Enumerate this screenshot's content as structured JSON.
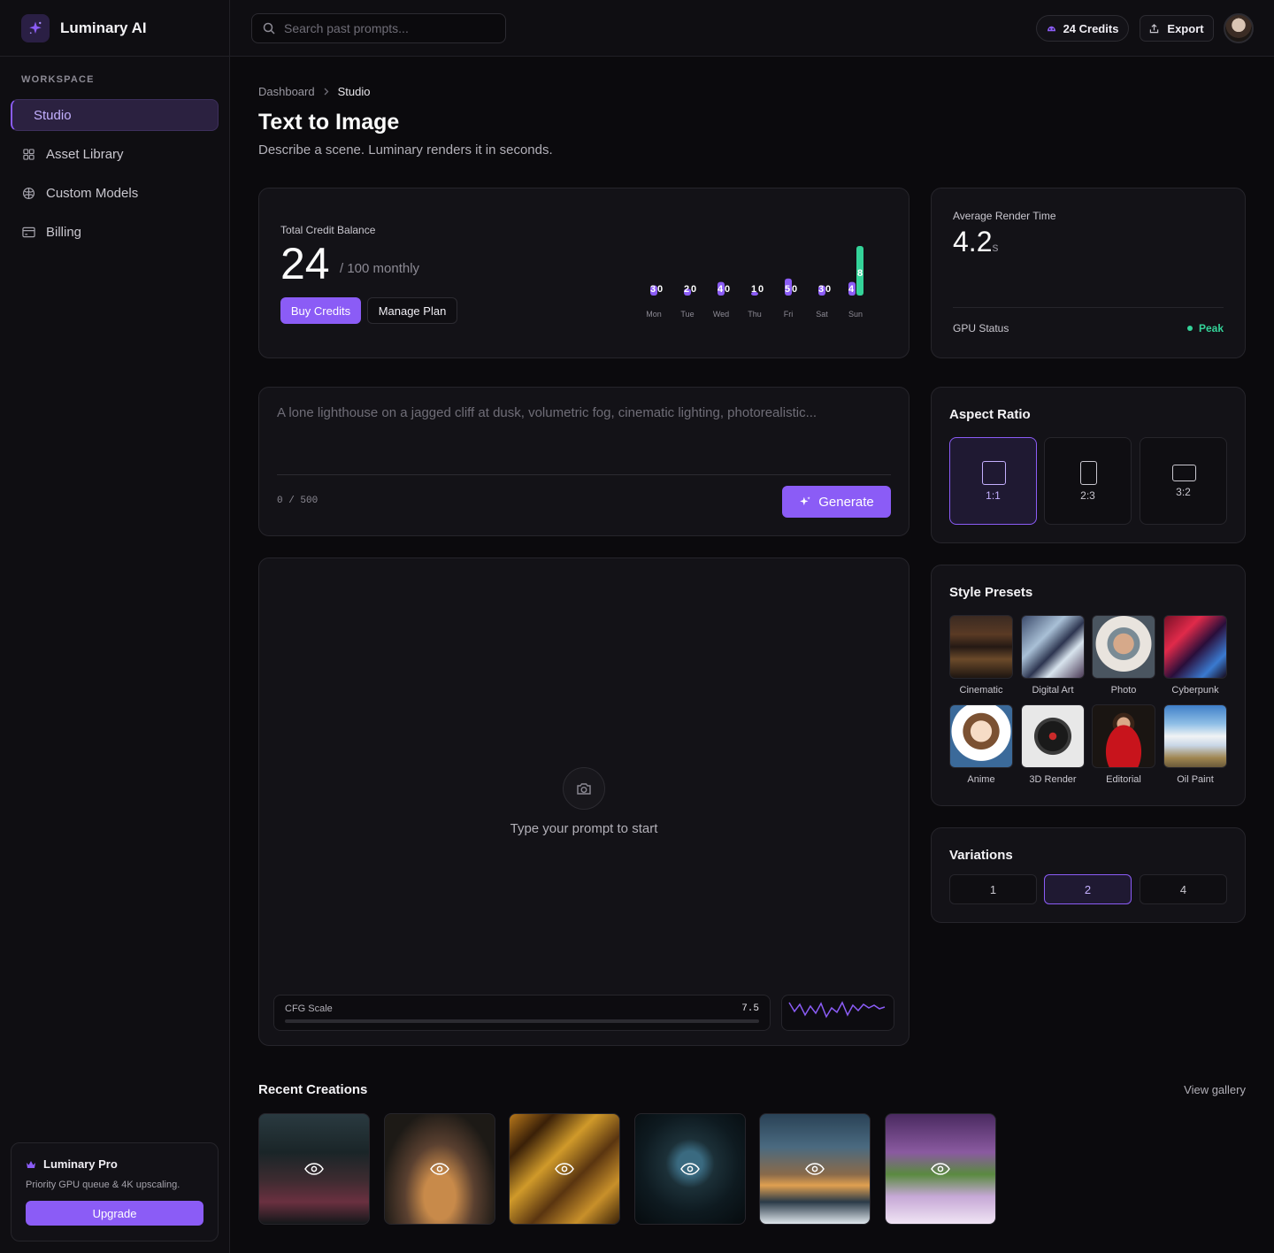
{
  "app": {
    "name": "Luminary AI"
  },
  "sidebar": {
    "section_label": "WORKSPACE",
    "items": [
      {
        "label": "Studio"
      },
      {
        "label": "Asset Library"
      },
      {
        "label": "Custom Models"
      },
      {
        "label": "Billing"
      }
    ],
    "pro": {
      "title": "Luminary Pro",
      "desc": "Priority GPU queue & 4K upscaling.",
      "cta": "Upgrade"
    }
  },
  "topbar": {
    "search_placeholder": "Search past prompts...",
    "credits": "24 Credits",
    "export": "Export"
  },
  "breadcrumb": {
    "parent": "Dashboard",
    "current": "Studio"
  },
  "page": {
    "title": "Text to Image",
    "subtitle": "Describe a scene. Luminary renders it in seconds."
  },
  "credits_card": {
    "label": "Total Credit Balance",
    "value": "24",
    "suffix": "/ 100 monthly",
    "buy": "Buy Credits",
    "manage": "Manage Plan"
  },
  "chart_data": {
    "type": "bar",
    "categories": [
      "Mon",
      "Tue",
      "Wed",
      "Thu",
      "Fri",
      "Sat",
      "Sun"
    ],
    "series": [
      {
        "values": [
          3,
          2,
          4,
          1,
          5,
          3,
          4
        ],
        "color": "#8b5cf6"
      },
      {
        "values": [
          0,
          0,
          0,
          0,
          0,
          0,
          8
        ],
        "color": "#34d399"
      }
    ],
    "ymax": 8,
    "grid": false
  },
  "render_card": {
    "label": "Average Render Time",
    "value": "4.2",
    "unit": "s",
    "gpu_label": "GPU Status",
    "gpu_value": "Peak"
  },
  "prompt": {
    "placeholder": "A lone lighthouse on a jagged cliff at dusk, volumetric fog, cinematic lighting, photorealistic...",
    "counter": "0 / 500",
    "generate": "Generate"
  },
  "preview": {
    "empty_text": "Type your prompt to start",
    "cfg_label": "CFG Scale",
    "cfg_value": "7.5"
  },
  "aspect": {
    "title": "Aspect Ratio",
    "options": [
      "1:1",
      "2:3",
      "3:2"
    ],
    "selected": "1:1"
  },
  "styles": {
    "title": "Style Presets",
    "items": [
      "Cinematic",
      "Digital Art",
      "Photo",
      "Cyberpunk",
      "Anime",
      "3D Render",
      "Editorial",
      "Oil Paint"
    ]
  },
  "variations": {
    "title": "Variations",
    "options": [
      "1",
      "2",
      "4"
    ],
    "selected": "2"
  },
  "recent": {
    "title": "Recent Creations",
    "view_all": "View gallery"
  },
  "colors": {
    "accent": "#8b5cf6",
    "success": "#34d399",
    "background": "#0b0a0d"
  }
}
